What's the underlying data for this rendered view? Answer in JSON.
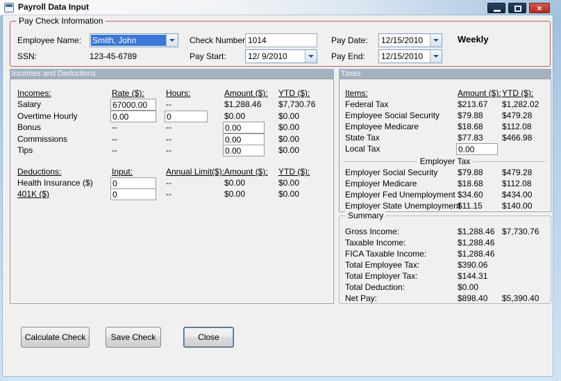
{
  "window": {
    "title": "Payroll Data Input"
  },
  "icons": {
    "close": "×"
  },
  "colors": {
    "titlebar_blue": "#a5c2e0",
    "close_red": "#ab2d26",
    "selection_blue": "#3b77d4",
    "section_header_bg": "#a4b1c0",
    "paycheck_group_border": "#bc5f5f",
    "client_bg": "#f0f0f0"
  },
  "paycheck": {
    "group_title": "Pay Check Information",
    "employee_name_label": "Employee Name:",
    "employee_name_value": "Smith, John",
    "ssn_label": "SSN:",
    "ssn_value": "123-45-6789",
    "check_number_label": "Check Number:",
    "check_number_value": "1014",
    "pay_start_label": "Pay Start:",
    "pay_start_value": "12/ 9/2010",
    "pay_date_label": "Pay Date:",
    "pay_date_value": "12/15/2010",
    "pay_end_label": "Pay End:",
    "pay_end_value": "12/15/2010",
    "frequency": "Weekly"
  },
  "section_headers": {
    "left": "Incomes and Deductions",
    "right": "Taxes"
  },
  "incomes": {
    "headers": {
      "c0": "Incomes:",
      "c1": "Rate ($):",
      "c2": "Hours:",
      "c3": "Amount ($):",
      "c4": "YTD ($):"
    },
    "rows": [
      {
        "label": "Salary",
        "rate": "67000.00",
        "hours": "--",
        "amount": "$1,288.46",
        "ytd": "$7,730.76"
      },
      {
        "label": "Overtime Hourly",
        "rate": "0.00",
        "hours": "0",
        "amount": "$0.00",
        "ytd": "$0.00"
      },
      {
        "label": "Bonus",
        "rate": "--",
        "hours": "--",
        "amount": "0.00",
        "ytd": "$0.00"
      },
      {
        "label": "Commissions",
        "rate": "--",
        "hours": "--",
        "amount": "0.00",
        "ytd": "$0.00"
      },
      {
        "label": "Tips",
        "rate": "--",
        "hours": "--",
        "amount": "0.00",
        "ytd": "$0.00"
      }
    ]
  },
  "deductions": {
    "headers": {
      "c0": "Deductions:",
      "c1": "Input:",
      "c2": "Annual Limit($):",
      "c3": "Amount ($):",
      "c4": "YTD ($):"
    },
    "rows": [
      {
        "label": "Health Insurance ($)",
        "input": "0",
        "limit": "--",
        "amount": "$0.00",
        "ytd": "$0.00"
      },
      {
        "label": "401K ($)",
        "input": "0",
        "limit": "--",
        "amount": "$0.00",
        "ytd": "$0.00"
      }
    ]
  },
  "taxes": {
    "headers": {
      "items": "Items:",
      "amount": "Amount ($):",
      "ytd": "YTD ($):"
    },
    "rows": [
      {
        "label": "Federal Tax",
        "amount": "$213.67",
        "ytd": "$1,282.02"
      },
      {
        "label": "Employee Social Security",
        "amount": "$79.88",
        "ytd": "$479.28"
      },
      {
        "label": "Employee Medicare",
        "amount": "$18.68",
        "ytd": "$112.08"
      },
      {
        "label": "State Tax",
        "amount": "$77.83",
        "ytd": "$466.98"
      },
      {
        "label": "Local Tax",
        "amount": "0.00",
        "ytd": ""
      }
    ],
    "employer_group_title": "Employer Tax",
    "employer_rows": [
      {
        "label": "Employer Social Security",
        "amount": "$79.88",
        "ytd": "$479.28"
      },
      {
        "label": "Employer Medicare",
        "amount": "$18.68",
        "ytd": "$112.08"
      },
      {
        "label": "Employer Fed Unemployment",
        "amount": "$34.60",
        "ytd": "$434.00"
      },
      {
        "label": "Employer State Unemployment",
        "amount": "$11.15",
        "ytd": "$140.00"
      }
    ]
  },
  "summary": {
    "group_title": "Summary",
    "rows": [
      {
        "label": "Gross Income:",
        "amount": "$1,288.46",
        "ytd": "$7,730.76"
      },
      {
        "label": "Taxable Income:",
        "amount": "$1,288.46",
        "ytd": ""
      },
      {
        "label": "FICA Taxable Income:",
        "amount": "$1,288.46",
        "ytd": ""
      },
      {
        "label": "Total Employee Tax:",
        "amount": "$390.06",
        "ytd": ""
      },
      {
        "label": "Total Employer Tax:",
        "amount": "$144.31",
        "ytd": ""
      },
      {
        "label": "Total Deduction:",
        "amount": "$0.00",
        "ytd": ""
      },
      {
        "label": "Net Pay:",
        "amount": "$898.40",
        "ytd": "$5,390.40"
      }
    ]
  },
  "buttons": {
    "calculate": "Calculate Check",
    "save": "Save Check",
    "close": "Close"
  }
}
